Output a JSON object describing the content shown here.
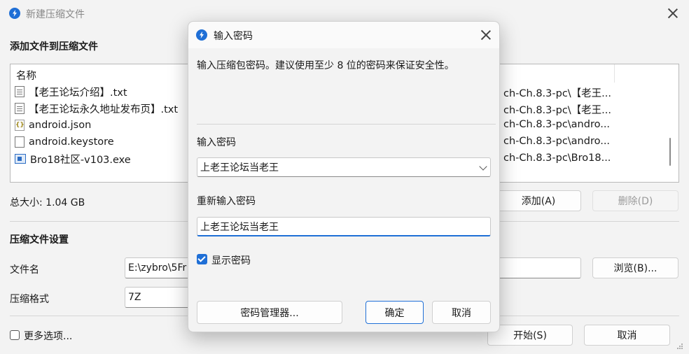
{
  "main_window": {
    "title": "新建压缩文件",
    "add_section_title": "添加文件到压缩文件",
    "list_header": "名称",
    "files": [
      {
        "name": "【老王论坛介绍】.txt",
        "icon": "txt-file-icon",
        "path": "ch-Ch.8.3-pc\\【老王..."
      },
      {
        "name": "【老王论坛永久地址发布页】.txt",
        "icon": "txt-file-icon",
        "path": "ch-Ch.8.3-pc\\【老王..."
      },
      {
        "name": "android.json",
        "icon": "json-file-icon",
        "path": "ch-Ch.8.3-pc\\andro..."
      },
      {
        "name": "android.keystore",
        "icon": "blank-file-icon",
        "path": "ch-Ch.8.3-pc\\andro..."
      },
      {
        "name": "Bro18社区-v103.exe",
        "icon": "exe-file-icon",
        "path": "ch-Ch.8.3-pc\\Bro18..."
      }
    ],
    "total_size": "总大小: 1.04 GB",
    "add_button": "添加(A)",
    "remove_button": "删除(D)",
    "settings_section_title": "压缩文件设置",
    "filename_label": "文件名",
    "filename_value": "E:\\zybro\\5Fr",
    "browse_button": "浏览(B)...",
    "format_label": "压缩格式",
    "format_value": "7Z",
    "more_options_label": "更多选项...",
    "start_button": "开始(S)",
    "cancel_button": "取消"
  },
  "dialog": {
    "title": "输入密码",
    "description": "输入压缩包密码。建议使用至少 8 位的密码来保证安全性。",
    "password_label": "输入密码",
    "password_value": "上老王论坛当老王",
    "repeat_label": "重新输入密码",
    "repeat_value": "上老王论坛当老王",
    "show_password_label": "显示密码",
    "show_password_checked": true,
    "password_manager_button": "密码管理器...",
    "ok_button": "确定",
    "cancel_button": "取消"
  },
  "colors": {
    "accent": "#1f6fd6",
    "window_bg": "#f3f3f3"
  }
}
